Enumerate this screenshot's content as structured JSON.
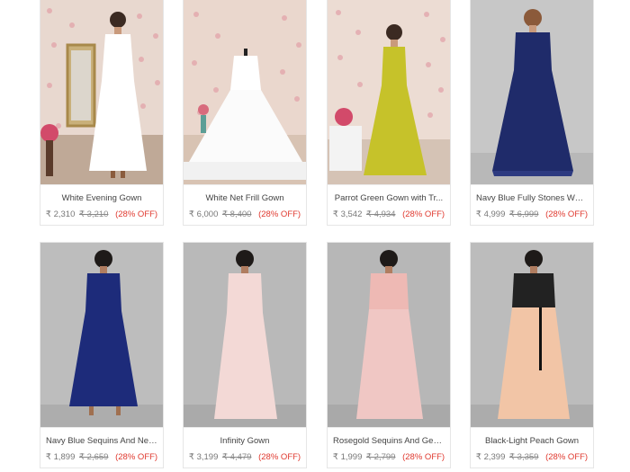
{
  "products": [
    {
      "name": "White Evening Gown",
      "price": "₹ 2,310",
      "old_price": "₹ 3,210",
      "discount": "(28% OFF)",
      "color": "#ffffff",
      "bg": "#e8d8cf"
    },
    {
      "name": "White Net Frill Gown",
      "price": "₹ 6,000",
      "old_price": "₹ 8,400",
      "discount": "(28% OFF)",
      "color": "#f7f7f7",
      "bg": "#ead7cd"
    },
    {
      "name": "Parrot Green Gown with Tr...",
      "price": "₹ 3,542",
      "old_price": "₹ 4,934",
      "discount": "(28% OFF)",
      "color": "#c6c22a",
      "bg": "#ecdcd3"
    },
    {
      "name": "Navy Blue Fully Stones Wor...",
      "price": "₹ 4,999",
      "old_price": "₹ 6,999",
      "discount": "(28% OFF)",
      "color": "#1f2b6a",
      "bg": "#c7c7c7"
    },
    {
      "name": "Navy Blue Sequins And Net...",
      "price": "₹ 1,899",
      "old_price": "₹ 2,659",
      "discount": "(28% OFF)",
      "color": "#1d2b7a",
      "bg": "#bdbdbd"
    },
    {
      "name": "Infinity Gown",
      "price": "₹ 3,199",
      "old_price": "₹ 4,479",
      "discount": "(28% OFF)",
      "color": "#f3d9d6",
      "bg": "#b9b9b9"
    },
    {
      "name": "Rosegold Sequins And Geo...",
      "price": "₹ 1,999",
      "old_price": "₹ 2,799",
      "discount": "(28% OFF)",
      "color": "#f0c7c4",
      "bg": "#b7b7b7"
    },
    {
      "name": "Black-Light Peach Gown",
      "price": "₹ 2,399",
      "old_price": "₹ 3,359",
      "discount": "(28% OFF)",
      "color": "#f2c5a6",
      "bg": "#bcbcbc"
    }
  ]
}
